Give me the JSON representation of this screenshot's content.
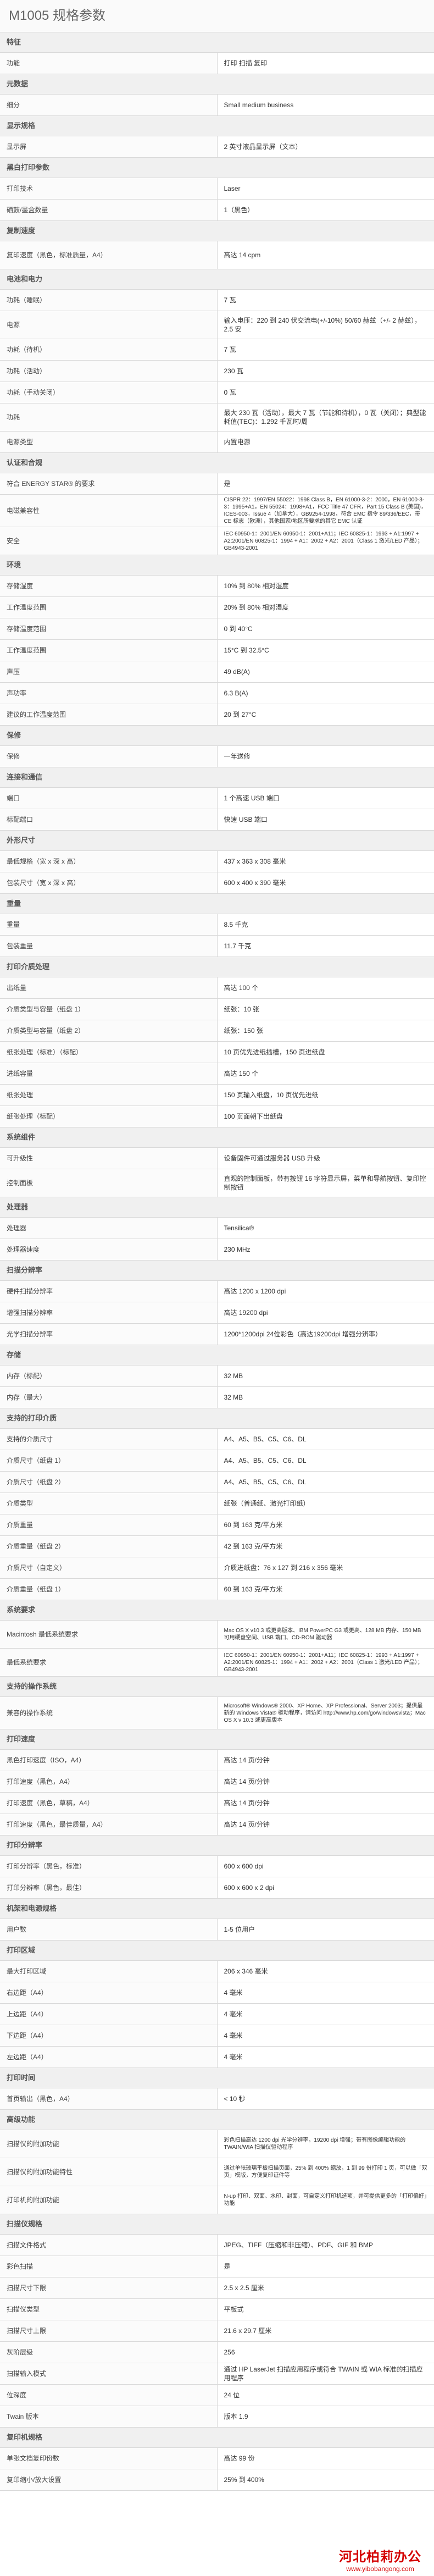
{
  "page_title": "M1005 规格参数",
  "sections": [
    {
      "title": "特征",
      "rows": [
        {
          "k": "功能",
          "v": "打印 扫描 复印"
        }
      ]
    },
    {
      "title": "元数据",
      "rows": [
        {
          "k": "细分",
          "v": "Small medium business"
        }
      ]
    },
    {
      "title": "显示规格",
      "rows": [
        {
          "k": "显示屏",
          "v": "2 英寸液晶显示屏（文本）"
        }
      ]
    },
    {
      "title": "黑白打印参数",
      "rows": [
        {
          "k": "打印技术",
          "v": "Laser"
        },
        {
          "k": "硒鼓/墨盒数量",
          "v": "1（黑色）"
        }
      ]
    },
    {
      "title": "复制速度",
      "rows": [
        {
          "k": "复印速度（黑色，标准质量，A4）",
          "v": "高达 14 cpm",
          "h": "tall"
        }
      ]
    },
    {
      "title": "电池和电力",
      "rows": [
        {
          "k": "功耗（睡眠）",
          "v": "7 瓦"
        },
        {
          "k": "电源",
          "v": "输入电压：220 到 240 伏交流电(+/-10%) 50/60 赫兹（+/- 2 赫兹），2.5 安",
          "h": "tall"
        },
        {
          "k": "功耗（待机）",
          "v": "7 瓦"
        },
        {
          "k": "功耗（活动）",
          "v": "230 瓦"
        },
        {
          "k": "功耗（手动关闭）",
          "v": "0 瓦"
        },
        {
          "k": "功耗",
          "v": "最大 230 瓦（活动），最大 7 瓦（节能和待机），0 瓦（关闭）；典型能耗值(TEC)：1.292 千瓦时/周",
          "h": "tall"
        },
        {
          "k": "电源类型",
          "v": "内置电源"
        }
      ]
    },
    {
      "title": "认证和合规",
      "rows": [
        {
          "k": "符合 ENERGY STAR® 的要求",
          "v": "是"
        },
        {
          "k": "电磁兼容性",
          "v": "CISPR 22：1997/EN 55022：1998 Class B，EN 61000-3-2：2000，EN 61000-3-3：1995+A1，EN 55024：1998+A1，FCC Title 47 CFR，Part 15 Class B (美国)，ICES-003，Issue 4（加拿大），GB9254-1998，符合 EMC 指令 89/336/EEC，带 CE 标志（欧洲），其他国家/地区所要求的其它 EMC 认证",
          "h": "xtall",
          "small": true
        },
        {
          "k": "安全",
          "v": "IEC 60950-1：2001/EN 60950-1：2001+A11；IEC 60825-1：1993 + A1:1997 + A2:2001/EN 60825-1：1994 + A1：2002 + A2：2001（Class 1 激光/LED 产品）；GB4943-2001",
          "h": "tall",
          "small": true
        }
      ]
    },
    {
      "title": "环境",
      "rows": [
        {
          "k": "存储湿度",
          "v": "10% 到 80% 相对湿度"
        },
        {
          "k": "工作温度范围",
          "v": "20% 到 80% 相对湿度"
        },
        {
          "k": "存储温度范围",
          "v": "0 到 40°C"
        },
        {
          "k": "工作温度范围",
          "v": "15°C 到 32.5°C"
        },
        {
          "k": "声压",
          "v": "49 dB(A)"
        },
        {
          "k": "声功率",
          "v": "6.3 B(A)"
        },
        {
          "k": "建议的工作温度范围",
          "v": "20 到 27°C"
        }
      ]
    },
    {
      "title": "保修",
      "rows": [
        {
          "k": "保修",
          "v": "一年送修"
        }
      ]
    },
    {
      "title": "连接和通信",
      "rows": [
        {
          "k": "端口",
          "v": "1 个高速 USB 端口"
        },
        {
          "k": "标配端口",
          "v": "快速 USB 端口"
        }
      ]
    },
    {
      "title": "外形尺寸",
      "rows": [
        {
          "k": "最低规格（宽 x 深 x 高）",
          "v": "437 x 363 x 308 毫米"
        },
        {
          "k": "包装尺寸（宽 x 深 x 高）",
          "v": "600 x 400 x 390 毫米"
        }
      ]
    },
    {
      "title": "重量",
      "rows": [
        {
          "k": "重量",
          "v": "8.5 千克"
        },
        {
          "k": "包装重量",
          "v": "11.7 千克"
        }
      ]
    },
    {
      "title": "打印介质处理",
      "rows": [
        {
          "k": "出纸量",
          "v": "高达 100 个"
        },
        {
          "k": "介质类型与容量（纸盘 1）",
          "v": "纸张：10 张"
        },
        {
          "k": "介质类型与容量（纸盘 2）",
          "v": "纸张：150 张"
        },
        {
          "k": "纸张处理（标准）（标配）",
          "v": "10 页优先进纸插槽，150 页进纸盘"
        },
        {
          "k": "进纸容量",
          "v": "高达 150 个"
        },
        {
          "k": "纸张处理",
          "v": "150 页输入纸盘，10 页优先进纸"
        },
        {
          "k": "纸张处理（标配）",
          "v": "100 页面朝下出纸盘"
        }
      ]
    },
    {
      "title": "系统组件",
      "rows": [
        {
          "k": "可升级性",
          "v": "设备固件可通过服务器 USB 升级"
        },
        {
          "k": "控制面板",
          "v": "直观的控制面板，带有按钮 16 字符显示屏，菜单和导航按钮、复印控制按钮",
          "h": "tall"
        }
      ]
    },
    {
      "title": "处理器",
      "rows": [
        {
          "k": "处理器",
          "v": "Tensilica®"
        },
        {
          "k": "处理器速度",
          "v": "230 MHz"
        }
      ]
    },
    {
      "title": "扫描分辨率",
      "rows": [
        {
          "k": "硬件扫描分辨率",
          "v": "高达 1200 x 1200 dpi"
        },
        {
          "k": "增强扫描分辨率",
          "v": "高达 19200 dpi"
        },
        {
          "k": "光学扫描分辨率",
          "v": "1200*1200dpi 24位彩色（高达19200dpi 增强分辨率）"
        }
      ]
    },
    {
      "title": "存储",
      "rows": [
        {
          "k": "内存（标配）",
          "v": "32 MB"
        },
        {
          "k": "内存（最大）",
          "v": "32 MB"
        }
      ]
    },
    {
      "title": "支持的打印介质",
      "rows": [
        {
          "k": "支持的介质尺寸",
          "v": "A4、A5、B5、C5、C6、DL"
        },
        {
          "k": "介质尺寸（纸盘 1）",
          "v": "A4、A5、B5、C5、C6、DL"
        },
        {
          "k": "介质尺寸（纸盘 2）",
          "v": "A4、A5、B5、C5、C6、DL"
        },
        {
          "k": "介质类型",
          "v": "纸张（普通纸、激光打印纸）"
        },
        {
          "k": "介质重量",
          "v": "60 到 163 克/平方米"
        },
        {
          "k": "介质重量（纸盘 2）",
          "v": "42 到 163 克/平方米"
        },
        {
          "k": "介质尺寸（自定义）",
          "v": "介质进纸盘：76 x 127 到 216 x 356 毫米"
        },
        {
          "k": "介质重量（纸盘 1）",
          "v": "60 到 163 克/平方米"
        }
      ]
    },
    {
      "title": "系统要求",
      "rows": [
        {
          "k": "Macintosh 最低系统要求",
          "v": "Mac OS X v10.3 或更高版本、IBM PowerPC G3 或更高、128 MB 内存、150 MB 可用硬盘空间、USB 端口、CD-ROM 驱动器",
          "h": "tall",
          "small": true
        },
        {
          "k": "最低系统要求",
          "v": "IEC 60950-1：2001/EN 60950-1：2001+A11；IEC 60825-1：1993 + A1:1997 + A2:2001/EN 60825-1：1994 + A1：2002 + A2：2001（Class 1 激光/LED 产品）；GB4943-2001",
          "h": "tall",
          "small": true
        }
      ]
    },
    {
      "title": "支持的操作系统",
      "rows": [
        {
          "k": "兼容的操作系统",
          "v": "Microsoft® Windows® 2000、XP Home、XP Professional、Server 2003；提供最新的 Windows Vista® 驱动程序，请访问 http://www.hp.com/go/windowsvista；Mac OS X v 10.3 或更高版本",
          "h": "xtall",
          "small": true
        }
      ]
    },
    {
      "title": "打印速度",
      "rows": [
        {
          "k": "黑色打印速度（ISO，A4）",
          "v": "高达 14 页/分钟"
        },
        {
          "k": "打印速度（黑色，A4）",
          "v": "高达 14 页/分钟"
        },
        {
          "k": "打印速度（黑色，草稿，A4）",
          "v": "高达 14 页/分钟"
        },
        {
          "k": "打印速度（黑色，最佳质量，A4）",
          "v": "高达 14 页/分钟"
        }
      ]
    },
    {
      "title": "打印分辨率",
      "rows": [
        {
          "k": "打印分辨率（黑色，标准）",
          "v": "600 x 600 dpi"
        },
        {
          "k": "打印分辨率（黑色，最佳）",
          "v": "600 x 600 x 2 dpi"
        }
      ]
    },
    {
      "title": "机架和电源规格",
      "rows": [
        {
          "k": "用户数",
          "v": "1-5 位用户"
        }
      ]
    },
    {
      "title": "打印区域",
      "rows": [
        {
          "k": "最大打印区域",
          "v": "206 x 346 毫米"
        },
        {
          "k": "右边距（A4）",
          "v": "4 毫米"
        },
        {
          "k": "上边距（A4）",
          "v": "4 毫米"
        },
        {
          "k": "下边距（A4）",
          "v": "4 毫米"
        },
        {
          "k": "左边距（A4）",
          "v": "4 毫米"
        }
      ]
    },
    {
      "title": "打印时间",
      "rows": [
        {
          "k": "首页输出（黑色，A4）",
          "v": "< 10 秒"
        }
      ]
    },
    {
      "title": "高级功能",
      "rows": [
        {
          "k": "扫描仪的附加功能",
          "v": "彩色扫描高达 1200 dpi 光学分辨率，19200 dpi 增强；带有图像编辑功能的 TWAIN/WIA 扫描仪驱动程序",
          "h": "tall",
          "small": true
        },
        {
          "k": "扫描仪的附加功能特性",
          "v": "通过单张玻璃平板扫描页面，25% 到 400% 缩放，1 到 99 份打印 1 页，可以做「双页」模版，方便复印证件等",
          "h": "tall",
          "small": true
        },
        {
          "k": "打印机的附加功能",
          "v": "N-up 打印、双面、水印、封面，可自定义打印机选项，并可提供更多的「打印偏好」功能",
          "h": "tall",
          "small": true
        }
      ]
    },
    {
      "title": "扫描仪规格",
      "rows": [
        {
          "k": "扫描文件格式",
          "v": "JPEG、TIFF（压缩和非压缩）、PDF、GIF 和 BMP"
        },
        {
          "k": "彩色扫描",
          "v": "是"
        },
        {
          "k": "扫描尺寸下限",
          "v": "2.5 x 2.5 厘米"
        },
        {
          "k": "扫描仪类型",
          "v": "平板式"
        },
        {
          "k": "扫描尺寸上限",
          "v": "21.6 x 29.7 厘米"
        },
        {
          "k": "灰阶层级",
          "v": "256"
        },
        {
          "k": "扫描输入模式",
          "v": "通过 HP LaserJet 扫描应用程序或符合 TWAIN 或 WIA 标准的扫描应用程序"
        },
        {
          "k": "位深度",
          "v": "24 位"
        },
        {
          "k": "Twain 版本",
          "v": "版本 1.9"
        }
      ]
    },
    {
      "title": "复印机规格",
      "rows": [
        {
          "k": "单张文档复印份数",
          "v": "高达 99 份"
        },
        {
          "k": "复印缩小/放大设置",
          "v": "25% 到 400%"
        }
      ]
    }
  ],
  "watermark": {
    "main": "河北柏莉办公",
    "url": "www.yibobangong.com"
  }
}
